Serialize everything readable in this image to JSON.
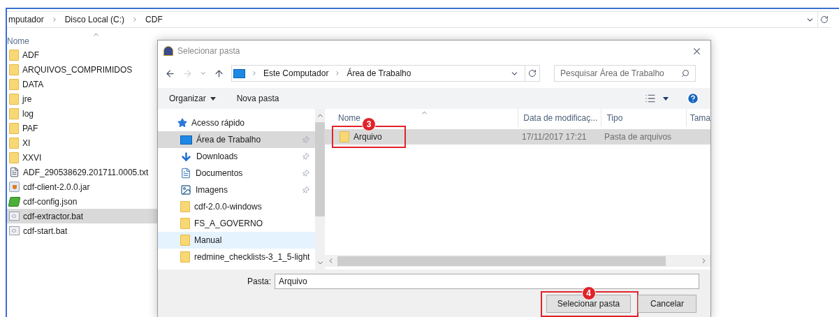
{
  "explorer": {
    "breadcrumb": [
      "mputador",
      "Disco Local (C:)",
      "CDF"
    ],
    "column_header": "Nome",
    "files": [
      {
        "name": "ADF",
        "kind": "folder",
        "selected": false
      },
      {
        "name": "ARQUIVOS_COMPRIMIDOS",
        "kind": "folder",
        "selected": false
      },
      {
        "name": "DATA",
        "kind": "folder",
        "selected": false
      },
      {
        "name": "jre",
        "kind": "folder",
        "selected": false
      },
      {
        "name": "log",
        "kind": "folder",
        "selected": false
      },
      {
        "name": "PAF",
        "kind": "folder",
        "selected": false
      },
      {
        "name": "XI",
        "kind": "folder",
        "selected": false
      },
      {
        "name": "XXVI",
        "kind": "folder",
        "selected": false
      },
      {
        "name": "ADF_290538629.201711.0005.txt",
        "kind": "text",
        "selected": false
      },
      {
        "name": "cdf-client-2.0.0.jar",
        "kind": "jar",
        "selected": false
      },
      {
        "name": "cdf-config.json",
        "kind": "json",
        "selected": false
      },
      {
        "name": "cdf-extractor.bat",
        "kind": "bat",
        "selected": true
      },
      {
        "name": "cdf-start.bat",
        "kind": "bat",
        "selected": false
      }
    ]
  },
  "dialog": {
    "title": "Selecionar pasta",
    "breadcrumb": [
      "Este Computador",
      "Área de Trabalho"
    ],
    "search": {
      "placeholder": "Pesquisar Área de Trabalho"
    },
    "toolbar": [
      {
        "label": "Organizar",
        "dropdown": true
      },
      {
        "label": "Nova pasta",
        "dropdown": false
      }
    ],
    "nav_items": [
      {
        "label": "Acesso rápido",
        "kind": "quick",
        "pinned": false,
        "selected": false,
        "hovered": false
      },
      {
        "label": "Área de Trabalho",
        "kind": "desktop",
        "pinned": true,
        "selected": true,
        "hovered": false
      },
      {
        "label": "Downloads",
        "kind": "downloads",
        "pinned": true,
        "selected": false,
        "hovered": false
      },
      {
        "label": "Documentos",
        "kind": "documents",
        "pinned": true,
        "selected": false,
        "hovered": false
      },
      {
        "label": "Imagens",
        "kind": "pictures",
        "pinned": true,
        "selected": false,
        "hovered": false
      },
      {
        "label": "cdf-2.0.0-windows",
        "kind": "folder",
        "pinned": false,
        "selected": false,
        "hovered": false
      },
      {
        "label": "FS_A_GOVERNO",
        "kind": "folder",
        "pinned": false,
        "selected": false,
        "hovered": false
      },
      {
        "label": "Manual",
        "kind": "folder",
        "pinned": false,
        "selected": false,
        "hovered": true
      },
      {
        "label": "redmine_checklists-3_1_5-light",
        "kind": "folder",
        "pinned": false,
        "selected": false,
        "hovered": false
      }
    ],
    "columns": [
      "Nome",
      "Data de modificaç...",
      "Tipo",
      "Tama"
    ],
    "rows": [
      {
        "name": "Arquivo",
        "date": "17/11/2017 17:21",
        "type": "Pasta de arquivos",
        "selected": true,
        "annotation": "3"
      }
    ],
    "folder_label": "Pasta:",
    "folder_value": "Arquivo",
    "buttons": [
      {
        "label": "Selecionar pasta",
        "annotation": "4"
      },
      {
        "label": "Cancelar"
      }
    ]
  }
}
